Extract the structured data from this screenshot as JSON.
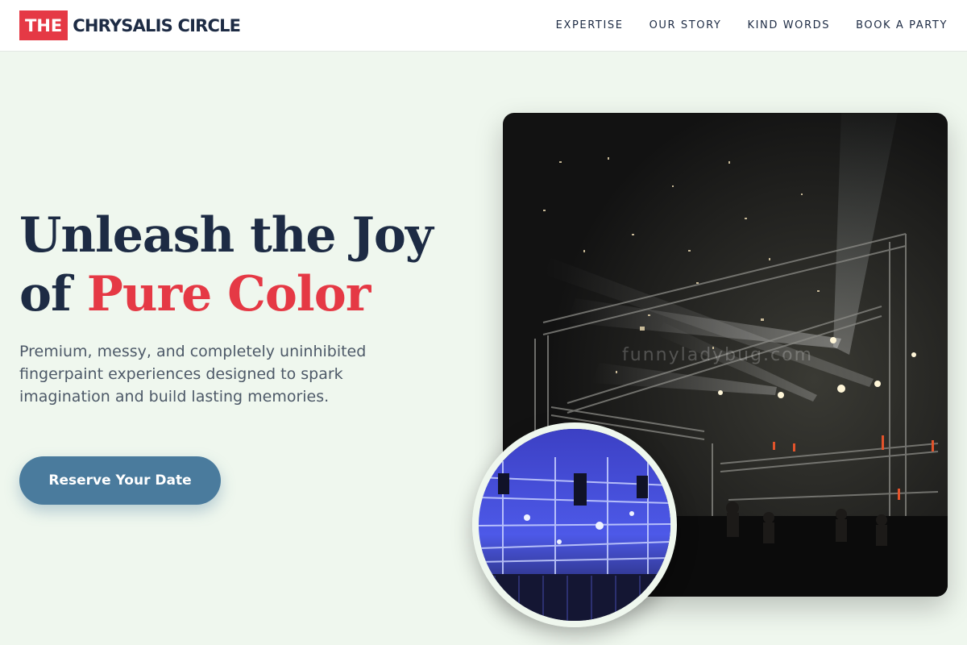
{
  "brand": {
    "prefix": "THE",
    "name": "CHRYSALIS CIRCLE"
  },
  "nav": {
    "links": [
      "EXPERTISE",
      "OUR STORY",
      "KIND WORDS",
      "BOOK A PARTY"
    ]
  },
  "hero": {
    "title_line1": "Unleash the Joy",
    "title_line2_prefix": "of ",
    "title_line2_accent": "Pure Color",
    "subtitle": "Premium, messy, and completely uninhibited fingerpaint experiences designed to spark imagination and build lasting memories.",
    "cta_label": "Reserve Your Date"
  },
  "images": {
    "main_alt": "Concert stage with spotlights and confetti",
    "inset_alt": "Stage rig lit with blue lights",
    "watermark": "funnyladybug.com"
  },
  "colors": {
    "accent_red": "#e53945",
    "navy": "#1d2b44",
    "cta_blue": "#4a7b9d",
    "background": "#eff7ee"
  }
}
